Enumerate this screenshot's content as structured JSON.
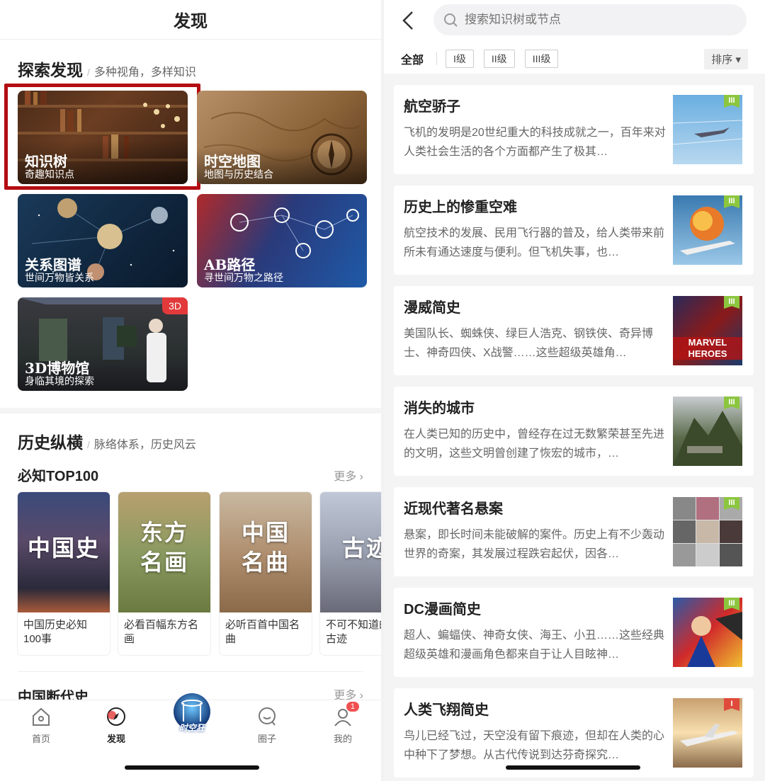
{
  "left": {
    "title": "发现",
    "explore": {
      "heading": "探索发现",
      "sub": "多种视角，多样知识"
    },
    "cards": [
      {
        "title": "知识树",
        "sub": "奇趣知识点"
      },
      {
        "title": "时空地图",
        "sub": "地图与历史结合"
      },
      {
        "title": "关系图谱",
        "sub": "世间万物皆关系"
      },
      {
        "title": "AB路径",
        "sub": "寻世间万物之路径"
      },
      {
        "title": "3D博物馆",
        "sub": "身临其境的探索",
        "badge": "3D"
      }
    ],
    "history": {
      "heading": "历史纵横",
      "sub": "脉络体系，历史风云"
    },
    "top100": {
      "title": "必知TOP100",
      "more": "更多 ›"
    },
    "posters": [
      {
        "big": "中国史",
        "caption": "中国历史必知100事"
      },
      {
        "big": "东方名画",
        "big1": "东方",
        "big2": "名画",
        "caption": "必看百幅东方名画"
      },
      {
        "big": "中国名曲",
        "big1": "中国",
        "big2": "名曲",
        "caption": "必听百首中国名曲"
      },
      {
        "big": "古迹",
        "caption": "不可不知道的大古迹"
      }
    ],
    "dynasty": {
      "title": "中国断代史",
      "more": "更多 ›"
    },
    "tabs": [
      {
        "label": "首页"
      },
      {
        "label": "发现"
      },
      {
        "label": "时空狂"
      },
      {
        "label": "圈子"
      },
      {
        "label": "我的",
        "badge": "1"
      }
    ]
  },
  "right": {
    "search_placeholder": "搜索知识树或节点",
    "filters": {
      "all": "全部",
      "chips": [
        "I级",
        "II级",
        "III级"
      ],
      "sort": "排序 ▾"
    },
    "items": [
      {
        "title": "航空骄子",
        "desc": "飞机的发明是20世纪重大的科技成就之一，百年来对人类社会生活的各个方面都产生了极其…",
        "level": "III"
      },
      {
        "title": "历史上的惨重空难",
        "desc": "航空技术的发展、民用飞行器的普及，给人类带来前所未有通达速度与便利。但飞机失事，也…",
        "level": "III"
      },
      {
        "title": "漫威简史",
        "desc": "美国队长、蜘蛛侠、绿巨人浩克、钢铁侠、奇异博士、神奇四侠、X战警……这些超级英雄角…",
        "level": "III",
        "thumb_text": "MARVEL HEROES"
      },
      {
        "title": "消失的城市",
        "desc": "在人类已知的历史中，曾经存在过无数繁荣甚至先进的文明，这些文明曾创建了恢宏的城市，…",
        "level": "III"
      },
      {
        "title": "近现代著名悬案",
        "desc": "悬案，即长时间未能破解的案件。历史上有不少轰动世界的奇案，其发展过程跌宕起伏，因各…",
        "level": "III"
      },
      {
        "title": "DC漫画简史",
        "desc": "超人、蝙蝠侠、神奇女侠、海王、小丑……这些经典超级英雄和漫画角色都来自于让人目眩神…",
        "level": "III"
      },
      {
        "title": "人类飞翔简史",
        "desc": "鸟儿已经飞过，天空没有留下痕迹，但却在人类的心中种下了梦想。从古代传说到达芬奇探究…",
        "level": "I"
      }
    ],
    "colors": {
      "level_green": "#8cc63f",
      "level_red": "#e04a3a",
      "accent": "#b30d12"
    }
  }
}
